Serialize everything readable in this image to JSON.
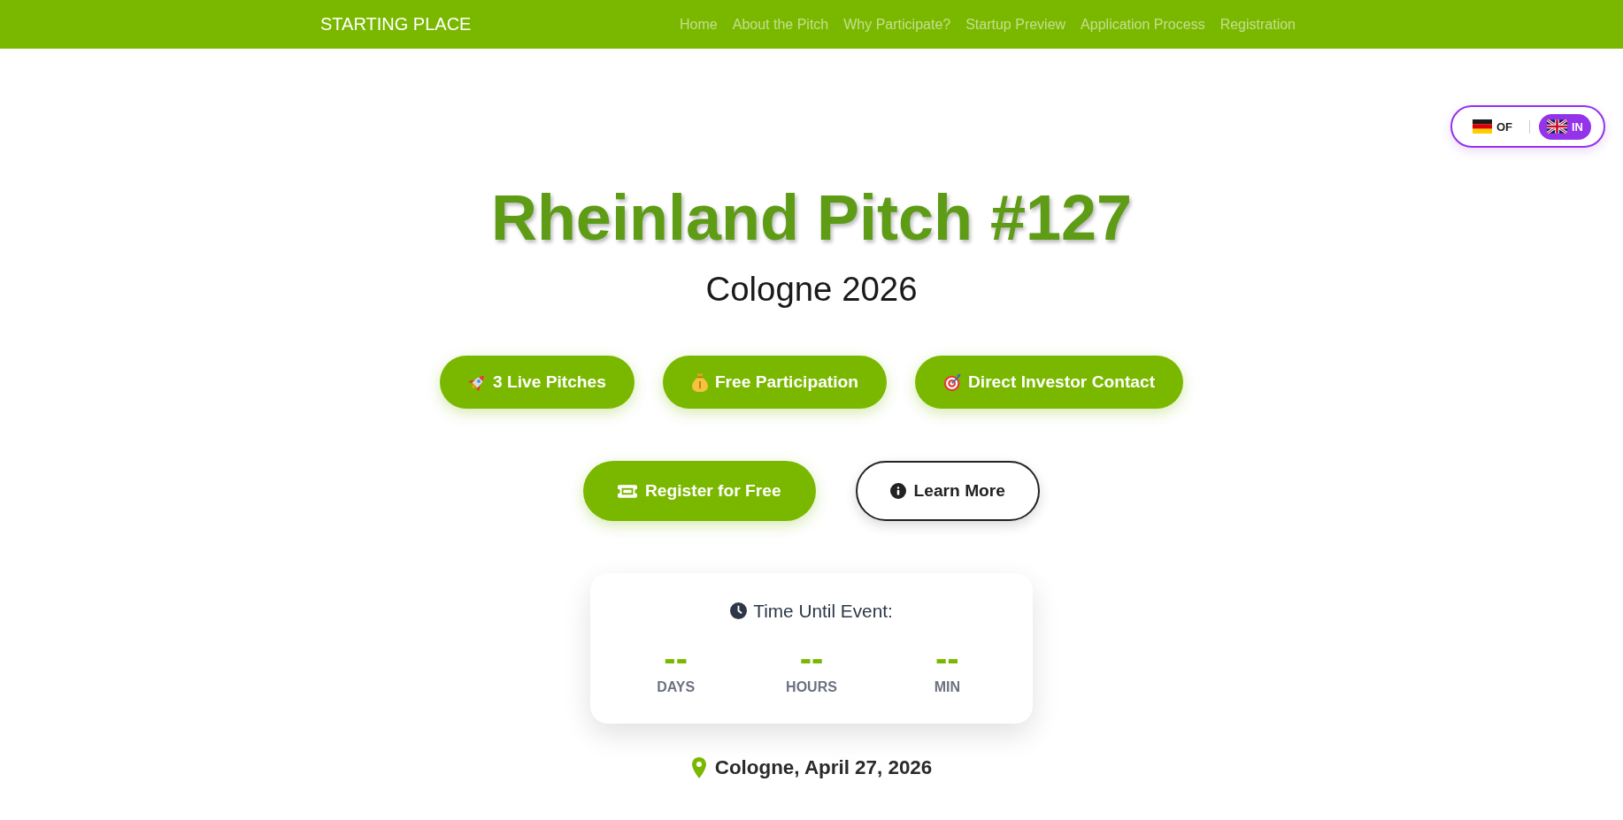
{
  "nav": {
    "brand": "STARTING PLACE",
    "links": [
      "Home",
      "About the Pitch",
      "Why Participate?",
      "Startup Preview",
      "Application Process",
      "Registration"
    ]
  },
  "language_switch": {
    "options": [
      {
        "label": "OF",
        "selected": false
      },
      {
        "label": "IN",
        "selected": true
      }
    ]
  },
  "hero": {
    "title": "Rheinland Pitch #127",
    "subtitle": "Cologne 2026",
    "features": [
      "3 Live Pitches",
      "Free Participation",
      "Direct Investor Contact"
    ],
    "buttons": [
      {
        "label": "Register for Free",
        "kind": "primary"
      },
      {
        "label": "Learn More",
        "kind": "outline"
      }
    ]
  },
  "countdown": {
    "title": "Time Until Event:",
    "units": [
      {
        "value": "--",
        "label": "DAYS"
      },
      {
        "value": "--",
        "label": "HOURS"
      },
      {
        "value": "--",
        "label": "MIN"
      }
    ]
  },
  "location": "Cologne, April 27, 2026"
}
